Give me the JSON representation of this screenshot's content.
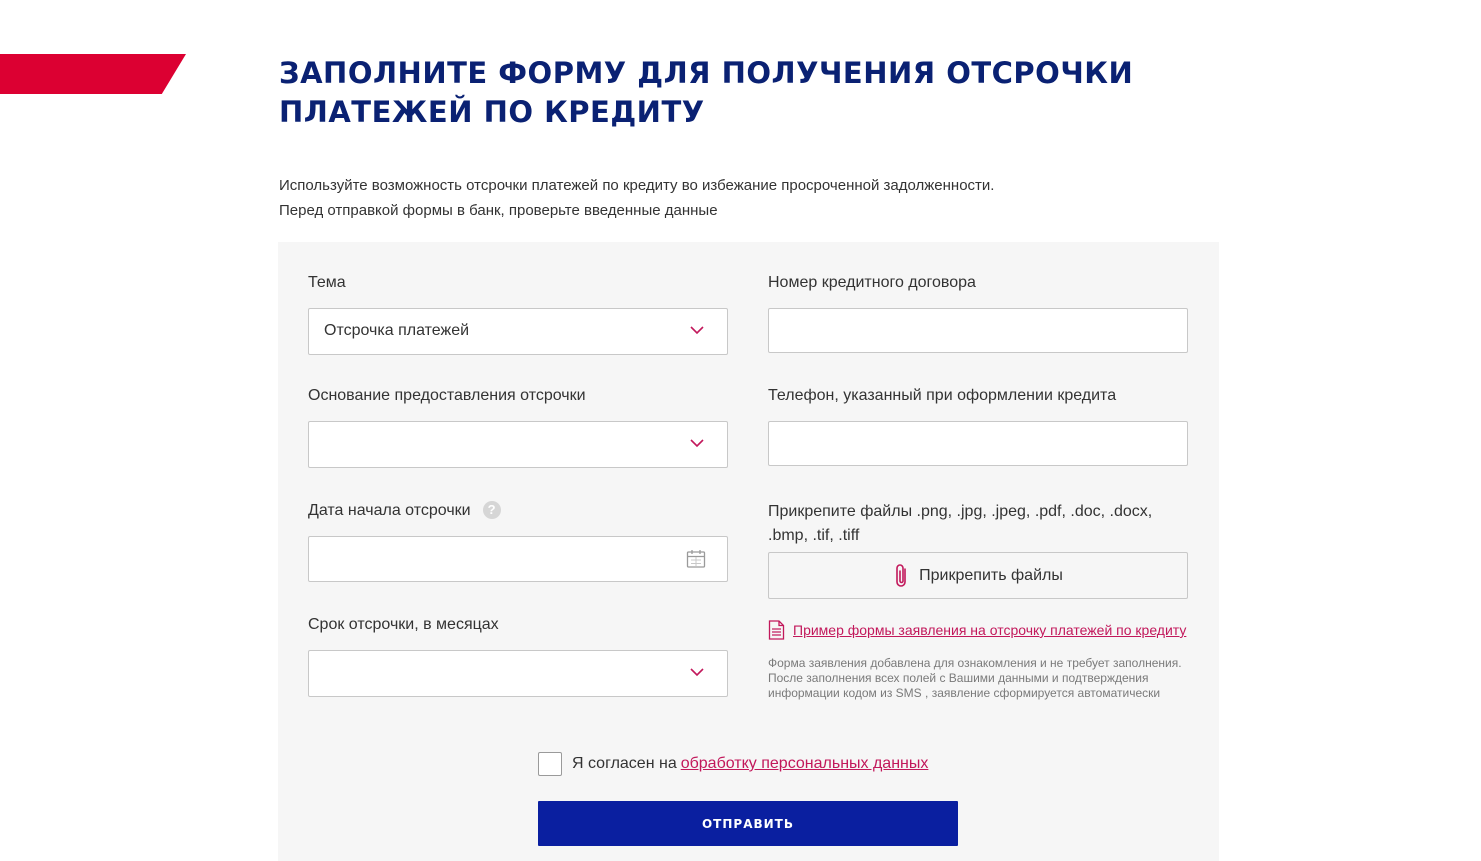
{
  "colors": {
    "brand_red": "#dc0032",
    "title_blue": "#0a2173",
    "button_blue": "#0a1fa0",
    "link_pink": "#c2185b"
  },
  "header": {
    "title_line1": "ЗАПОЛНИТЕ ФОРМУ ДЛЯ ПОЛУЧЕНИЯ ОТСРОЧКИ",
    "title_line2": "ПЛАТЕЖЕЙ ПО КРЕДИТУ",
    "subtitle_line1": "Используйте возможность отсрочки платежей по кредиту во избежание просроченной задолженности.",
    "subtitle_line2": "Перед отправкой формы в банк, проверьте введенные данные"
  },
  "form": {
    "topic": {
      "label": "Тема",
      "value": "Отсрочка платежей"
    },
    "contract_number": {
      "label": "Номер кредитного договора",
      "value": ""
    },
    "reason": {
      "label": "Основание предоставления отсрочки",
      "value": ""
    },
    "phone": {
      "label": "Телефон, указанный при оформлении кредита",
      "value": ""
    },
    "start_date": {
      "label": "Дата начала отсрочки",
      "help_glyph": "?",
      "value": ""
    },
    "attach": {
      "label_line1": "Прикрепите файлы .png, .jpg, .jpeg, .pdf, .doc, .docx,",
      "label_line2": ".bmp, .tif, .tiff",
      "button_label": "Прикрепить файлы"
    },
    "term": {
      "label": "Срок отсрочки, в месяцах",
      "value": ""
    },
    "example_link": "Пример формы заявления на отсрочку платежей по кредиту",
    "note_line1": "Форма заявления добавлена для ознакомления и не требует заполнения.",
    "note_line2": "После заполнения всех полей с Вашими данными и подтверждения",
    "note_line3": "информации кодом из SMS , заявление сформируется автоматически",
    "agree_text": "Я согласен на",
    "agree_link": "обработку персональных данных",
    "submit_label": "ОТПРАВИТЬ"
  }
}
